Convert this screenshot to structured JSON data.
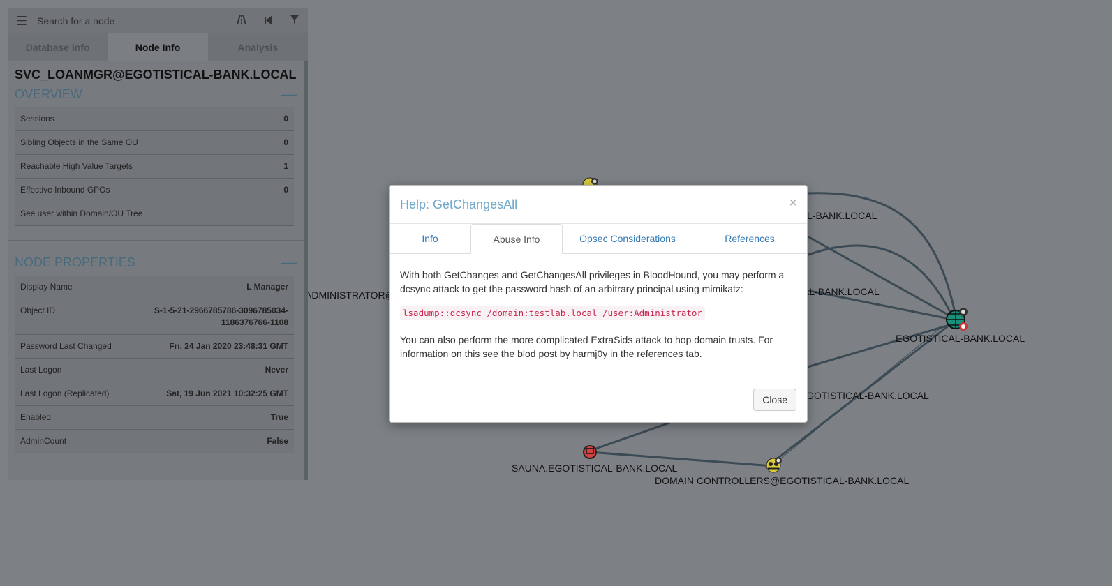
{
  "search": {
    "placeholder": "Search for a node"
  },
  "toolbar_icons": [
    "menu-icon",
    "road-icon",
    "back-icon",
    "filter-icon"
  ],
  "tabs": [
    {
      "label": "Database Info"
    },
    {
      "label": "Node Info"
    },
    {
      "label": "Analysis"
    }
  ],
  "node": {
    "title": "SVC_LOANMGR@EGOTISTICAL-BANK.LOCAL",
    "overview_header": "OVERVIEW",
    "overview": [
      {
        "label": "Sessions",
        "value": "0"
      },
      {
        "label": "Sibling Objects in the Same OU",
        "value": "0"
      },
      {
        "label": "Reachable High Value Targets",
        "value": "1"
      },
      {
        "label": "Effective Inbound GPOs",
        "value": "0"
      },
      {
        "label": "See user within Domain/OU Tree",
        "value": ""
      }
    ],
    "properties_header": "NODE PROPERTIES",
    "properties": [
      {
        "label": "Display Name",
        "value": "L Manager"
      },
      {
        "label": "Object ID",
        "value": "S-1-5-21-2966785786-3096785034-1186376766-1108"
      },
      {
        "label": "Password Last Changed",
        "value": "Fri, 24 Jan 2020 23:48:31 GMT"
      },
      {
        "label": "Last Logon",
        "value": "Never"
      },
      {
        "label": "Last Logon (Replicated)",
        "value": "Sat, 19 Jun 2021 10:32:25 GMT"
      },
      {
        "label": "Enabled",
        "value": "True"
      },
      {
        "label": "AdminCount",
        "value": "False"
      }
    ]
  },
  "graph": {
    "labels": [
      {
        "text": "L-BANK.LOCAL"
      },
      {
        "text": "AL-BANK.LOCAL"
      },
      {
        "text": "ADMINISTRATOR@"
      },
      {
        "text": "EGOTISTICAL-BANK.LOCAL"
      },
      {
        "text": "GOTISTICAL-BANK.LOCAL"
      },
      {
        "text": "SAUNA.EGOTISTICAL-BANK.LOCAL"
      },
      {
        "text": "DOMAIN CONTROLLERS@EGOTISTICAL-BANK.LOCAL"
      }
    ]
  },
  "modal": {
    "title": "Help: GetChangesAll",
    "close_x": "×",
    "tabs": [
      {
        "label": "Info"
      },
      {
        "label": "Abuse Info"
      },
      {
        "label": "Opsec Considerations"
      },
      {
        "label": "References"
      }
    ],
    "para1": "With both GetChanges and GetChangesAll privileges in BloodHound, you may perform a dcsync attack to get the password hash of an arbitrary principal using mimikatz:",
    "code": "lsadump::dcsync /domain:testlab.local /user:Administrator",
    "para2": "You can also perform the more complicated ExtraSids attack to hop domain trusts. For information on this see the blod post by harmj0y in the references tab.",
    "close_button": "Close"
  }
}
